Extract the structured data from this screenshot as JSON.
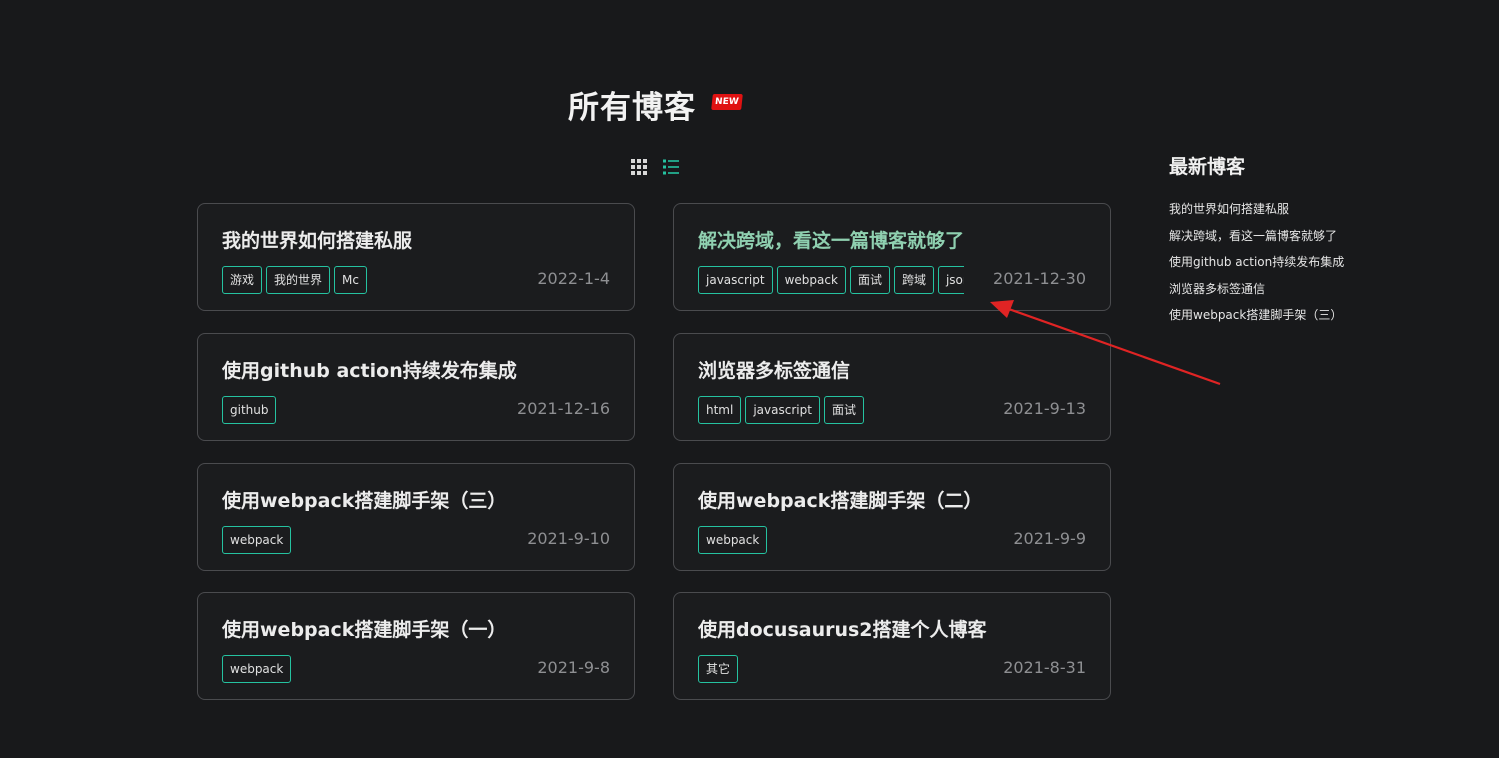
{
  "header": {
    "title": "所有博客",
    "badge": "NEW"
  },
  "view_toggle": {
    "grid_icon": "grid-icon",
    "list_icon": "list-icon",
    "active_color": "#25c2a0"
  },
  "posts": [
    {
      "title": "我的世界如何搭建私服",
      "tags": [
        "游戏",
        "我的世界",
        "Mc"
      ],
      "date": "2022-1-4"
    },
    {
      "title": "解决跨域，看这一篇博客就够了",
      "tags": [
        "javascript",
        "webpack",
        "面试",
        "跨域",
        "jsonp"
      ],
      "date": "2021-12-30"
    },
    {
      "title": "使用github action持续发布集成",
      "tags": [
        "github"
      ],
      "date": "2021-12-16"
    },
    {
      "title": "浏览器多标签通信",
      "tags": [
        "html",
        "javascript",
        "面试"
      ],
      "date": "2021-9-13"
    },
    {
      "title": "使用webpack搭建脚手架（三）",
      "tags": [
        "webpack"
      ],
      "date": "2021-9-10"
    },
    {
      "title": "使用webpack搭建脚手架（二）",
      "tags": [
        "webpack"
      ],
      "date": "2021-9-9"
    },
    {
      "title": "使用webpack搭建脚手架（一）",
      "tags": [
        "webpack"
      ],
      "date": "2021-9-8"
    },
    {
      "title": "使用docusaurus2搭建个人博客",
      "tags": [
        "其它"
      ],
      "date": "2021-8-31"
    }
  ],
  "sidebar": {
    "title": "最新博客",
    "items": [
      "我的世界如何搭建私服",
      "解决跨域，看这一篇博客就够了",
      "使用github action持续发布集成",
      "浏览器多标签通信",
      "使用webpack搭建脚手架（三）"
    ]
  },
  "colors": {
    "background": "#18191b",
    "accent": "#25c2a0",
    "hover_title": "#8fd0b0",
    "badge": "#e01212",
    "annotation_arrow": "#e02424"
  }
}
